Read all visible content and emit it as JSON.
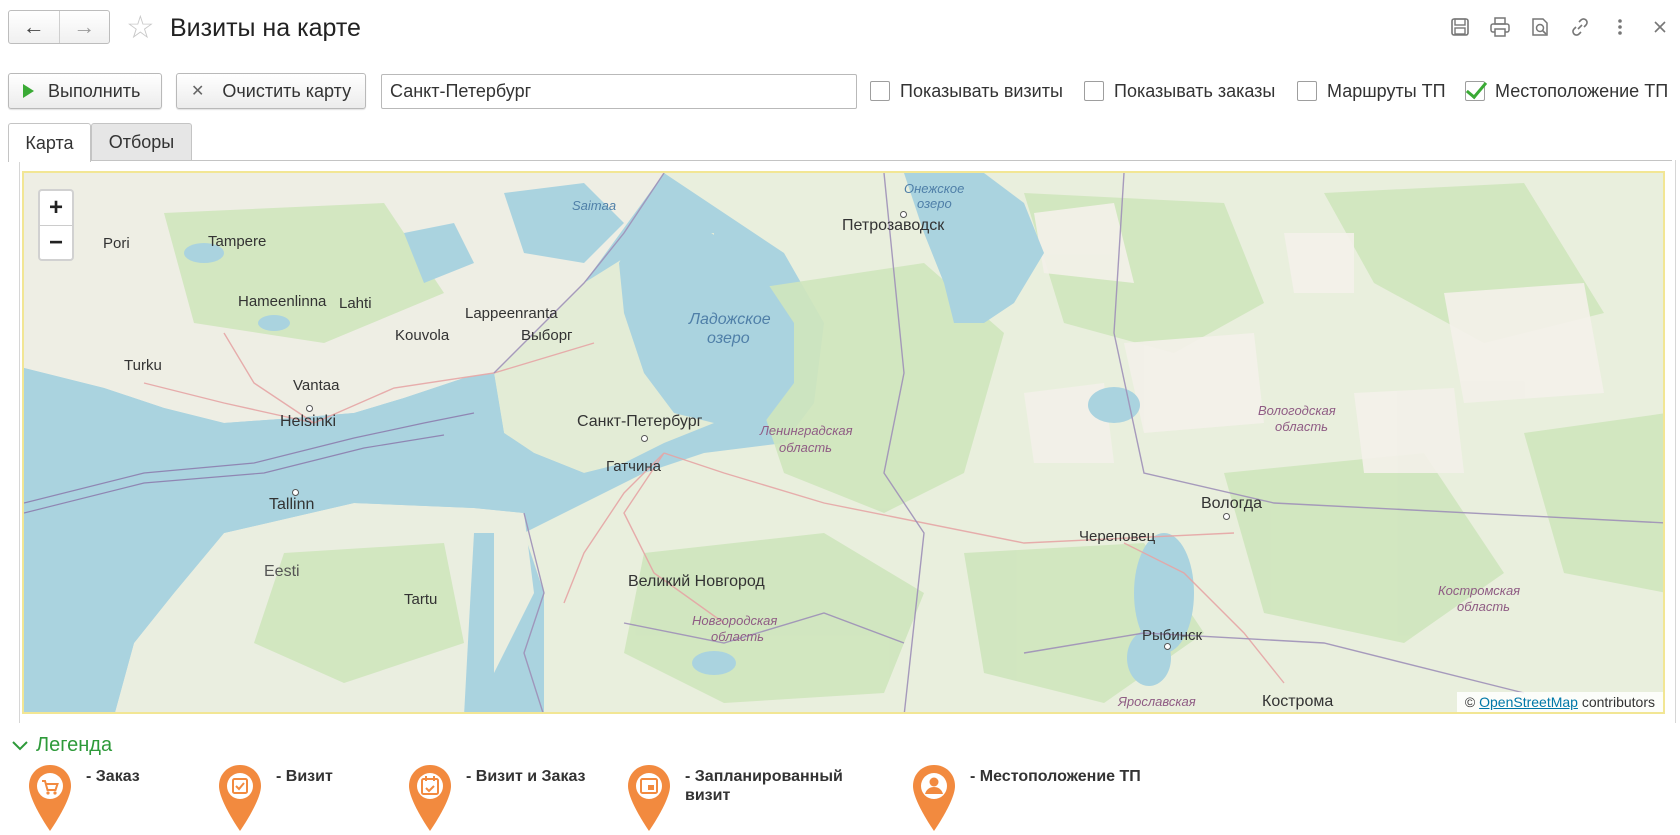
{
  "window": {
    "title": "Визиты на карте",
    "icons": [
      "save-icon",
      "print-icon",
      "preview-icon",
      "link-icon",
      "more-icon",
      "close-icon"
    ]
  },
  "toolbar": {
    "run_label": "Выполнить",
    "clear_label": "Очистить карту",
    "city_value": "Санкт-Петербург",
    "checkboxes": [
      {
        "label": "Показывать визиты",
        "checked": false
      },
      {
        "label": "Показывать заказы",
        "checked": false
      },
      {
        "label": "Маршруты ТП",
        "checked": false
      },
      {
        "label": "Местоположение ТП",
        "checked": true
      }
    ]
  },
  "tabs": [
    {
      "label": "Карта",
      "active": true
    },
    {
      "label": "Отборы",
      "active": false
    }
  ],
  "map": {
    "zoom_in": "+",
    "zoom_out": "−",
    "labels": {
      "saimaa": "Saimaa",
      "onega_1": "Онежское",
      "onega_2": "озеро",
      "petrozavodsk": "Петрозаводск",
      "pori": "Pori",
      "tampere": "Tampere",
      "hameenlinna": "Hameenlinna",
      "lahti": "Lahti",
      "lappeenranta": "Lappeenranta",
      "kouvola": "Kouvola",
      "vyborg": "Выборг",
      "ladoga_1": "Ладожское",
      "ladoga_2": "озеро",
      "turku": "Turku",
      "vantaa": "Vantaa",
      "helsinki": "Helsinki",
      "spb": "Санкт-Петербург",
      "leningrad_1": "Ленинградская",
      "leningrad_2": "область",
      "gatchina": "Гатчина",
      "vologda_reg_1": "Вологодская",
      "vologda_reg_2": "область",
      "tallinn": "Tallinn",
      "vologda": "Вологда",
      "cherepovets": "Череповец",
      "eesti": "Eesti",
      "tartu": "Tartu",
      "novgorod": "Великий Новгород",
      "novgorod_reg_1": "Новгородская",
      "novgorod_reg_2": "область",
      "kostroma_reg_1": "Костромская",
      "kostroma_reg_2": "область",
      "rybinsk": "Рыбинск",
      "yaroslavl_reg": "Ярославская",
      "kostroma": "Кострома"
    },
    "attribution": {
      "prefix": "©",
      "link": "OpenStreetMap",
      "suffix": "contributors"
    },
    "colors": {
      "water": "#aad3df",
      "land": "#f2efe9",
      "forest": "#c8e3b3",
      "border": "#9e90b8"
    }
  },
  "legend": {
    "title": "Легенда",
    "pin_color": "#f28a3f",
    "items": [
      {
        "icon": "cart-icon",
        "line1": "- Заказ",
        "line2": ""
      },
      {
        "icon": "visit-icon",
        "line1": "- Визит",
        "line2": ""
      },
      {
        "icon": "calendar-check-icon",
        "line1": "- Визит и Заказ",
        "line2": ""
      },
      {
        "icon": "planned-visit-icon",
        "line1": "- Запланированный",
        "line2": "визит"
      },
      {
        "icon": "person-icon",
        "line1": "- Местоположение ТП",
        "line2": ""
      }
    ]
  }
}
